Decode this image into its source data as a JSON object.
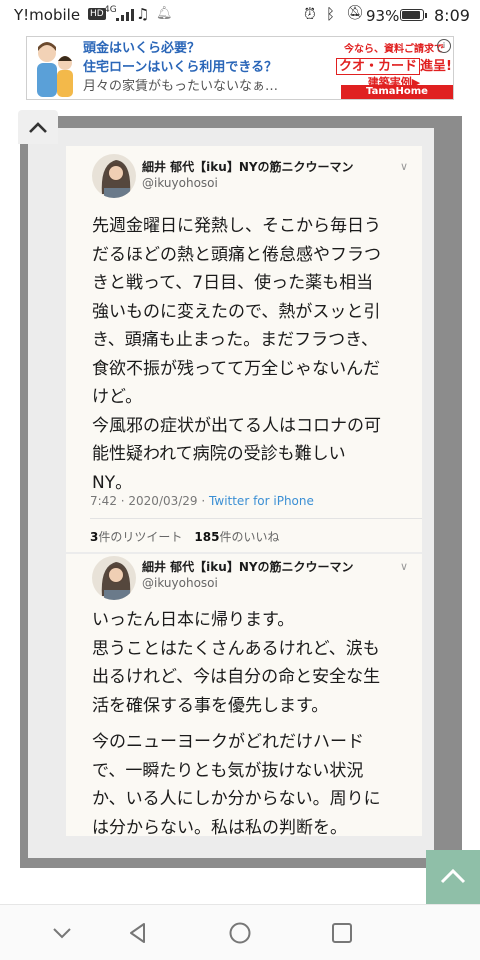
{
  "status_bar": {
    "carrier": "Y!mobile",
    "hd_badge": "HD",
    "network": "4G",
    "battery_percent": "93%",
    "battery_level": 0.93,
    "time": "8:09",
    "icons": [
      "signal-icon",
      "music-note-icon",
      "bell-icon",
      "alarm-icon",
      "bluetooth-icon",
      "mute-icon",
      "battery-icon"
    ]
  },
  "ad": {
    "lines": [
      "頭金はいくら必要？",
      "住宅ローンはいくら利用できる？",
      "月々の家賃がもったいないなぁ…"
    ],
    "right_line1": "今なら、資料ご請求で",
    "right_line2_boxed": "クオ・カード",
    "right_line2_suffix": "進呈!",
    "right_line3": "建築実例",
    "right_line3_arrow": "▶",
    "brand": "TamaHome",
    "adchoice": "i",
    "colors": {
      "text_blue": "#2a66b8",
      "brand_red": "#e02020"
    }
  },
  "tweets": [
    {
      "display_name": "細井 郁代【iku】NYの筋ニクウーマン",
      "handle": "@ikuyohosoi",
      "caret": "∨",
      "lines": [
        "先週金曜日に発熱し、そこから毎日う",
        "だるほどの熱と頭痛と倦怠感やフラつ",
        "きと戦って、7日目、使った薬も相当",
        "強いものに変えたので、熱がスッと引",
        "き、頭痛も止まった。まだフラつき、",
        "食欲不振が残ってて万全じゃないんだ",
        "けど。",
        "今風邪の症状が出てる人はコロナの可",
        "能性疑われて病院の受診も難しい",
        "NY。"
      ],
      "time": "7:42",
      "date": "2020/03/29",
      "source": "Twitter for iPhone",
      "retweets_count": "3",
      "retweets_label": "件のリツイート",
      "likes_count": "185",
      "likes_label": "件のいいね"
    },
    {
      "display_name": "細井 郁代【iku】NYの筋ニクウーマン",
      "handle": "@ikuyohosoi",
      "caret": "∨",
      "lines": [
        "いったん日本に帰ります。",
        "思うことはたくさんあるけれど、涙も",
        "出るけれど、今は自分の命と安全な生",
        "活を確保する事を優先します。",
        "今のニューヨークがどれだけハード",
        "で、一瞬たりとも気が抜けない状況",
        "か、いる人にしか分からない。周りに",
        "は分からない。私は私の判断を。"
      ]
    }
  ],
  "nav": {
    "icons": [
      "chevron-down-icon",
      "back-icon",
      "home-icon",
      "recents-icon"
    ]
  },
  "colors": {
    "tweet_bg": "#fbf9f4",
    "frame": "#8c8c8c",
    "scroll_top_button": "#8fbfa8",
    "link_blue": "#3b8fd4"
  }
}
